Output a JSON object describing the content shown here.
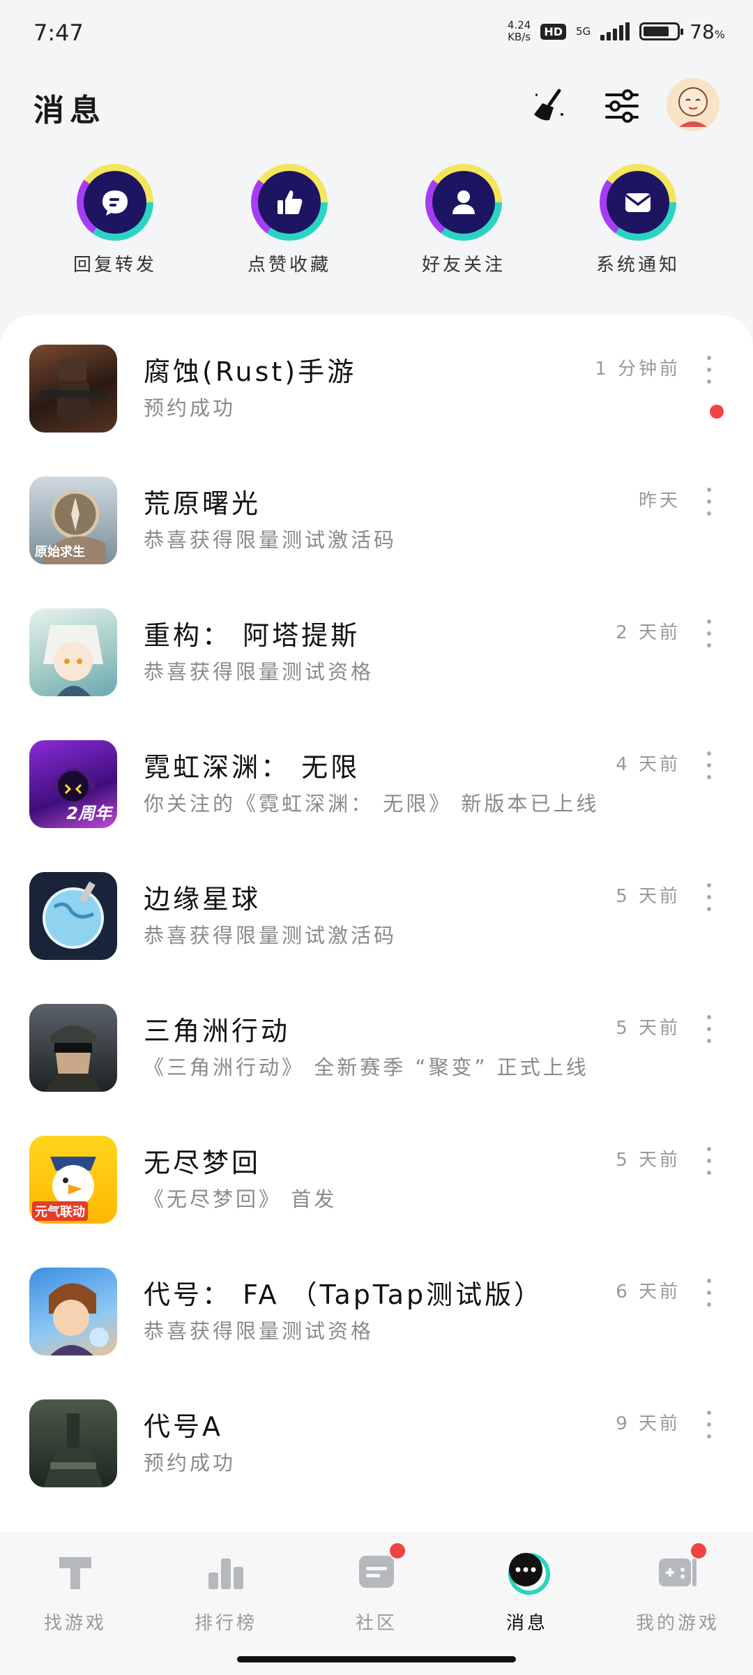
{
  "status": {
    "time": "7:47",
    "speed_value": "4.24",
    "speed_unit": "KB/s",
    "hd": "HD",
    "network": "5G",
    "battery": "78",
    "battery_unit": "%",
    "battery_level": 0.78
  },
  "header": {
    "title": "消息"
  },
  "quick_actions": [
    {
      "label": "回复转发",
      "icon": "reply-icon"
    },
    {
      "label": "点赞收藏",
      "icon": "thumbs-up-icon"
    },
    {
      "label": "好友关注",
      "icon": "person-icon"
    },
    {
      "label": "系统通知",
      "icon": "mail-icon"
    }
  ],
  "messages": [
    {
      "title": "腐蚀(Rust)手游",
      "subtitle": "预约成功",
      "time": "1 分钟前",
      "unread": true
    },
    {
      "title": "荒原曙光",
      "subtitle": "恭喜获得限量测试激活码",
      "time": "昨天",
      "unread": false,
      "thumb_text": "原始求生"
    },
    {
      "title": "重构： 阿塔提斯",
      "subtitle": "恭喜获得限量测试资格",
      "time": "2 天前",
      "unread": false
    },
    {
      "title": "霓虹深渊： 无限",
      "subtitle": "你关注的《霓虹深渊： 无限》 新版本已上线",
      "time": "4 天前",
      "unread": false,
      "thumb_text": "2周年"
    },
    {
      "title": "边缘星球",
      "subtitle": "恭喜获得限量测试激活码",
      "time": "5 天前",
      "unread": false
    },
    {
      "title": "三角洲行动",
      "subtitle": "《三角洲行动》 全新赛季 “聚变” 正式上线",
      "time": "5 天前",
      "unread": false
    },
    {
      "title": "无尽梦回",
      "subtitle": "《无尽梦回》 首发",
      "time": "5 天前",
      "unread": false,
      "thumb_text": "元气联动"
    },
    {
      "title": "代号： FA （TapTap测试版）",
      "subtitle": "恭喜获得限量测试资格",
      "time": "6 天前",
      "unread": false
    },
    {
      "title": "代号A",
      "subtitle": "预约成功",
      "time": "9 天前",
      "unread": false
    }
  ],
  "bottom_nav": [
    {
      "label": "找游戏",
      "icon": "find-games-icon",
      "active": false,
      "badge": false
    },
    {
      "label": "排行榜",
      "icon": "ranking-icon",
      "active": false,
      "badge": false
    },
    {
      "label": "社区",
      "icon": "community-icon",
      "active": false,
      "badge": true
    },
    {
      "label": "消息",
      "icon": "message-icon",
      "active": true,
      "badge": false
    },
    {
      "label": "我的游戏",
      "icon": "my-games-icon",
      "active": false,
      "badge": true
    }
  ],
  "colors": {
    "accent_teal": "#2bd4c2",
    "badge_red": "#ef4444",
    "quick_icon_bg": "#1d1561"
  }
}
